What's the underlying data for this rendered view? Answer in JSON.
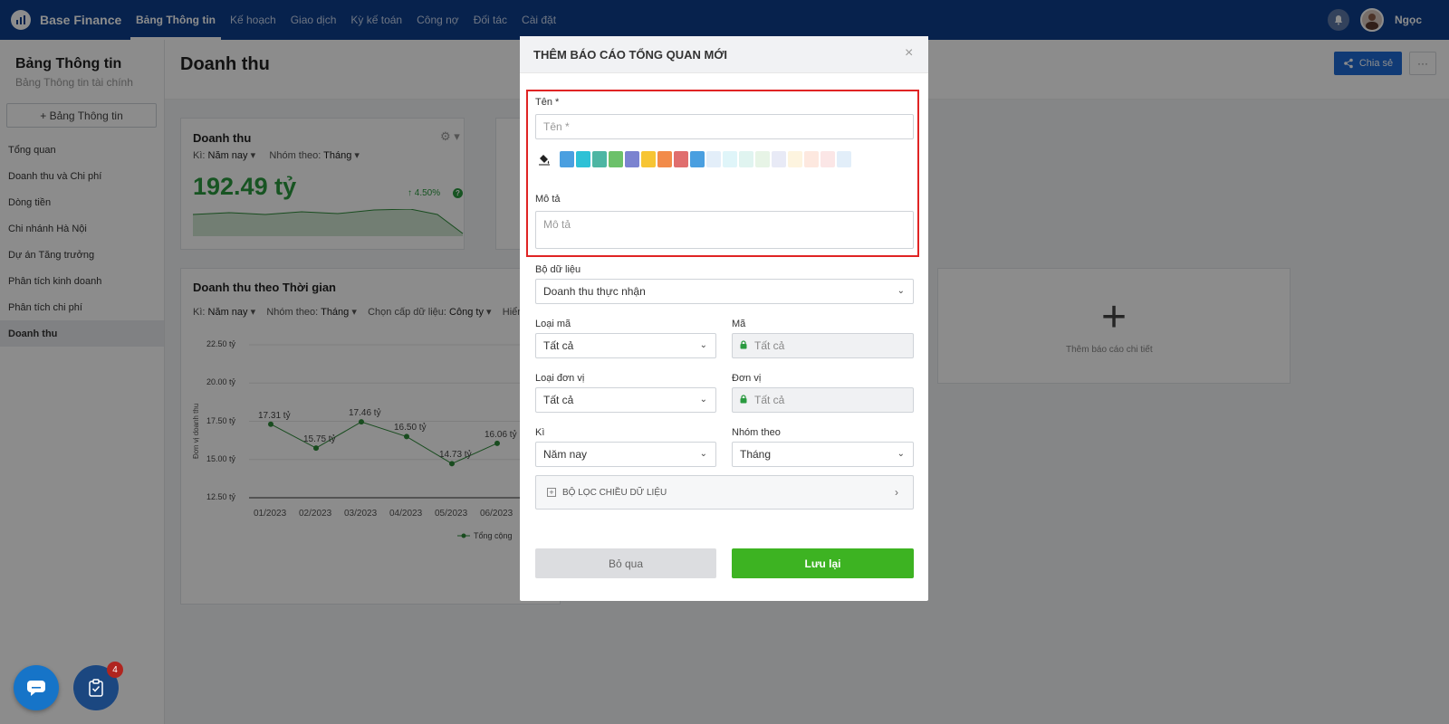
{
  "app": {
    "name": "Base Finance",
    "user": "Ngọc"
  },
  "nav": [
    "Bảng Thông tin",
    "Kế hoạch",
    "Giao dịch",
    "Kỳ kế toán",
    "Công nợ",
    "Đối tác",
    "Cài đặt"
  ],
  "sidebar": {
    "title": "Bảng Thông tin",
    "subtitle": "Bảng Thông tin tài chính",
    "add_label": "+ Bảng Thông tin",
    "items": [
      "Tổng quan",
      "Doanh thu và Chi phí",
      "Dòng tiền",
      "Chi nhánh Hà Nội",
      "Dự án Tăng trưởng",
      "Phân tích kinh doanh",
      "Phân tích chi phí",
      "Doanh thu"
    ]
  },
  "page": {
    "title": "Doanh thu",
    "share_label": "Chia sẻ",
    "more_label": "···"
  },
  "card1": {
    "title": "Doanh thu",
    "period_label": "Kì:",
    "period_value": "Năm nay",
    "group_label": "Nhóm theo:",
    "group_value": "Tháng",
    "kpi": "192.49 tỷ",
    "change": "4.50%"
  },
  "card2": {
    "title": "Doanh thu theo Thời gian",
    "period_label": "Kì:",
    "period_value": "Năm nay",
    "group_label": "Nhóm theo:",
    "group_value": "Tháng",
    "level_label": "Chọn cấp dữ liệu:",
    "level_value": "Công ty",
    "more_filter": "Hiển",
    "legend": "Tổng cộng",
    "ylabel": "Đơn vị doanh thu"
  },
  "add_card": {
    "label": "Thêm báo cáo chi tiết"
  },
  "chart_data": {
    "type": "line",
    "title": "Doanh thu theo Thời gian",
    "ylabel": "Đơn vị doanh thu",
    "y_ticks": [
      "22.50 tỷ",
      "20.00 tỷ",
      "17.50 tỷ",
      "15.00 tỷ",
      "12.50 tỷ"
    ],
    "ylim": [
      12.5,
      22.5
    ],
    "categories": [
      "01/2023",
      "02/2023",
      "03/2023",
      "04/2023",
      "05/2023",
      "06/2023"
    ],
    "series": [
      {
        "name": "Tổng cộng",
        "values": [
          17.31,
          15.75,
          17.46,
          16.5,
          14.73,
          16.06
        ],
        "labels": [
          "17.31 tỷ",
          "15.75 tỷ",
          "17.46 tỷ",
          "16.50 tỷ",
          "14.73 tỷ",
          "16.06 tỷ"
        ]
      }
    ],
    "color": "#2e8b3a"
  },
  "modal": {
    "title": "THÊM BÁO CÁO TỔNG QUAN MỚI",
    "close": "×",
    "name_label": "Tên *",
    "name_placeholder": "Tên *",
    "desc_label": "Mô tả",
    "desc_placeholder": "Mô tả",
    "colors": [
      "#4a9fe0",
      "#2ec1d6",
      "#4db6a3",
      "#6cc16a",
      "#7b83d0",
      "#f7c534",
      "#f28b4a",
      "#e06e6e",
      "#4a9fe0",
      "#e3eef9",
      "#dff5f9",
      "#e0f4f0",
      "#e7f4e6",
      "#e8eaf6",
      "#fdf4df",
      "#fde8df",
      "#fbe6e6",
      "#e2eef9"
    ],
    "dataset_label": "Bộ dữ liệu",
    "dataset_value": "Doanh thu thực nhận",
    "code_type_label": "Loại mã",
    "code_type_value": "Tất cả",
    "code_label": "Mã",
    "code_value": "Tất cả",
    "unit_type_label": "Loại đơn vị",
    "unit_type_value": "Tất cả",
    "unit_label": "Đơn vị",
    "unit_value": "Tất cả",
    "period_label": "Kì",
    "period_value": "Năm nay",
    "group_label": "Nhóm theo",
    "group_value": "Tháng",
    "filter_label": "BỘ LỌC CHIỀU DỮ LIỆU",
    "cancel_label": "Bỏ qua",
    "save_label": "Lưu lại"
  },
  "fab": {
    "badge": "4"
  }
}
